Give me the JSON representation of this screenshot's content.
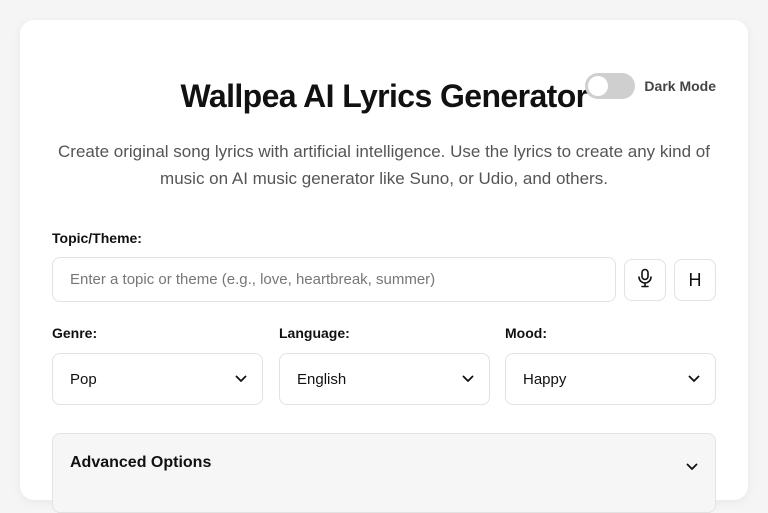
{
  "header": {
    "title": "Wallpea AI Lyrics Generator",
    "dark_mode_label": "Dark Mode",
    "dark_mode_on": false,
    "subtitle": "Create original song lyrics with artificial intelligence. Use the lyrics to create any kind of music on AI music generator like Suno, or Udio, and others."
  },
  "topic": {
    "label": "Topic/Theme:",
    "value": "",
    "placeholder": "Enter a topic or theme (e.g., love, heartbreak, summer)",
    "mic_icon": "microphone-icon",
    "history_button_label": "H"
  },
  "selects": {
    "genre": {
      "label": "Genre:",
      "value": "Pop"
    },
    "language": {
      "label": "Language:",
      "value": "English"
    },
    "mood": {
      "label": "Mood:",
      "value": "Happy"
    }
  },
  "advanced": {
    "label": "Advanced Options",
    "icon": "chevron-down-icon"
  },
  "colors": {
    "page_bg": "#f5f5f5",
    "card_bg": "#ffffff",
    "toggle_off": "#cfcfcf",
    "border": "#e2e2e2",
    "text": "#111111",
    "muted_text": "#555555"
  }
}
